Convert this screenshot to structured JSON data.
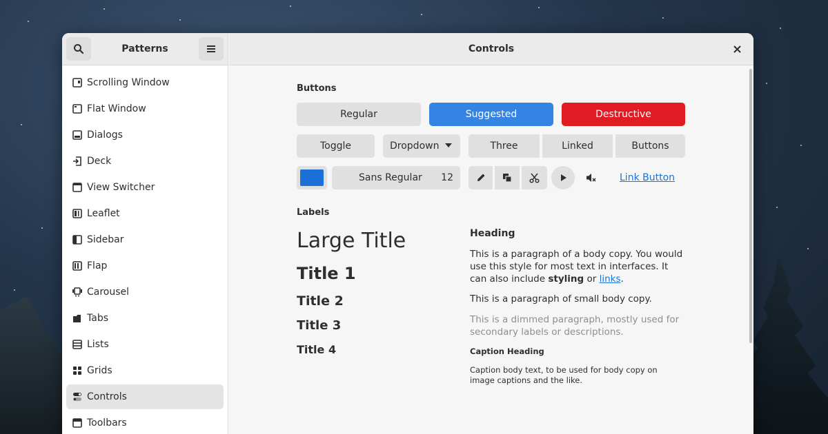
{
  "sidebar": {
    "title": "Patterns",
    "items": [
      {
        "label": "Scrolling Window",
        "icon": "scrolling-window-icon"
      },
      {
        "label": "Flat Window",
        "icon": "flat-window-icon"
      },
      {
        "label": "Dialogs",
        "icon": "dialogs-icon"
      },
      {
        "label": "Deck",
        "icon": "deck-icon"
      },
      {
        "label": "View Switcher",
        "icon": "view-switcher-icon"
      },
      {
        "label": "Leaflet",
        "icon": "leaflet-icon"
      },
      {
        "label": "Sidebar",
        "icon": "sidebar-icon"
      },
      {
        "label": "Flap",
        "icon": "flap-icon"
      },
      {
        "label": "Carousel",
        "icon": "carousel-icon"
      },
      {
        "label": "Tabs",
        "icon": "tabs-icon"
      },
      {
        "label": "Lists",
        "icon": "lists-icon"
      },
      {
        "label": "Grids",
        "icon": "grids-icon"
      },
      {
        "label": "Controls",
        "icon": "controls-icon",
        "selected": true
      },
      {
        "label": "Toolbars",
        "icon": "toolbars-icon"
      }
    ]
  },
  "content": {
    "title": "Controls",
    "buttons_section": "Buttons",
    "row1": {
      "regular": "Regular",
      "suggested": "Suggested",
      "destructive": "Destructive"
    },
    "row2": {
      "toggle": "Toggle",
      "dropdown": "Dropdown",
      "three": "Three",
      "linked": "Linked",
      "buttons": "Buttons"
    },
    "row3": {
      "font_name": "Sans Regular",
      "font_size": "12",
      "link_button": "Link Button"
    },
    "labels_section": "Labels",
    "titles": {
      "large": "Large Title",
      "t1": "Title 1",
      "t2": "Title 2",
      "t3": "Title 3",
      "t4": "Title 4"
    },
    "text": {
      "heading": "Heading",
      "body_pre": "This is a paragraph of a body copy. You would use this style for most text in interfaces. It can also include ",
      "body_bold": "styling",
      "body_mid": " or ",
      "body_link": "links",
      "body_end": ".",
      "small": "This is a paragraph of small body copy.",
      "dimmed": "This is a dimmed paragraph, mostly used for secondary labels or descriptions.",
      "caption_heading": "Caption Heading",
      "caption_body": "Caption body text, to be used for body copy on image captions and the like."
    }
  },
  "colors": {
    "accent": "#3584e4",
    "destructive": "#e01b24",
    "color_swatch": "#1c71d8",
    "link": "#1c71d8"
  }
}
